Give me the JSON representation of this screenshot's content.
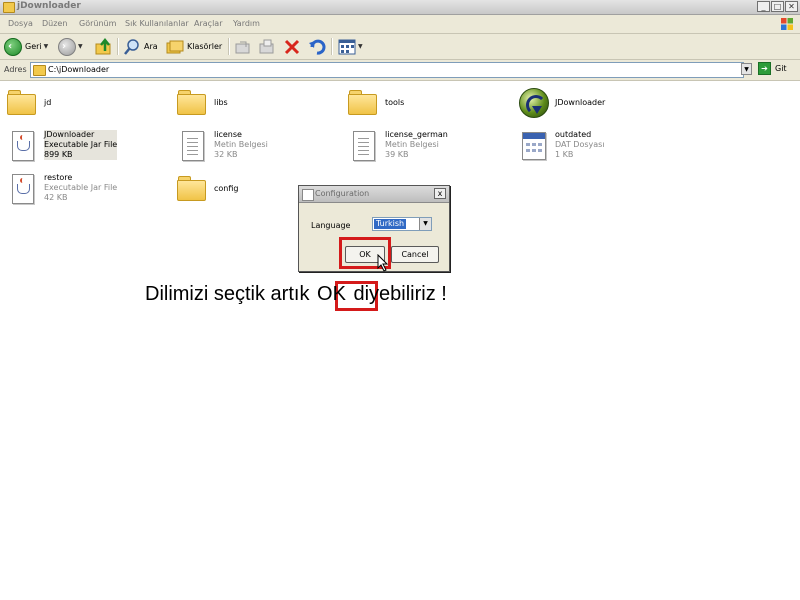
{
  "window": {
    "title": "jDownloader",
    "controls": {
      "minimize": "_",
      "maximize": "□",
      "close": "✕"
    }
  },
  "menubar": {
    "items": [
      "Dosya",
      "Düzen",
      "Görünüm",
      "Sık Kullanılanlar",
      "Araçlar",
      "Yardım"
    ]
  },
  "toolbar": {
    "back_label": "Geri",
    "search_label": "Ara",
    "folders_label": "Klasörler"
  },
  "address": {
    "label": "Adres",
    "value": "C:\\jDownloader",
    "go_label": "Git"
  },
  "files": [
    {
      "name": "jd",
      "type": "folder"
    },
    {
      "name": "libs",
      "type": "folder"
    },
    {
      "name": "tools",
      "type": "folder"
    },
    {
      "name": "JDownloader",
      "type": "jd-app"
    },
    {
      "name": "JDownloader",
      "line2": "Executable Jar File",
      "line3": "899 KB",
      "type": "jar"
    },
    {
      "name": "license",
      "line2": "Metin Belgesi",
      "line3": "32 KB",
      "type": "text"
    },
    {
      "name": "license_german",
      "line2": "Metin Belgesi",
      "line3": "39 KB",
      "type": "text"
    },
    {
      "name": "outdated",
      "line2": "DAT Dosyası",
      "line3": "1 KB",
      "type": "dat"
    },
    {
      "name": "restore",
      "line2": "Executable Jar File",
      "line3": "42 KB",
      "type": "jar"
    },
    {
      "name": "config",
      "type": "folder"
    }
  ],
  "dialog": {
    "title": "Configuration",
    "close": "x",
    "language_label": "Language",
    "language_value": "Turkish",
    "ok_label": "OK",
    "cancel_label": "Cancel"
  },
  "caption": {
    "before": "Dilimizi seçtik artık ",
    "highlight": "OK",
    "after": " diyebiliriz !"
  },
  "colors": {
    "highlight_red": "#d41a1a",
    "selection_blue": "#316ac5",
    "chrome": "#ece9d8"
  }
}
